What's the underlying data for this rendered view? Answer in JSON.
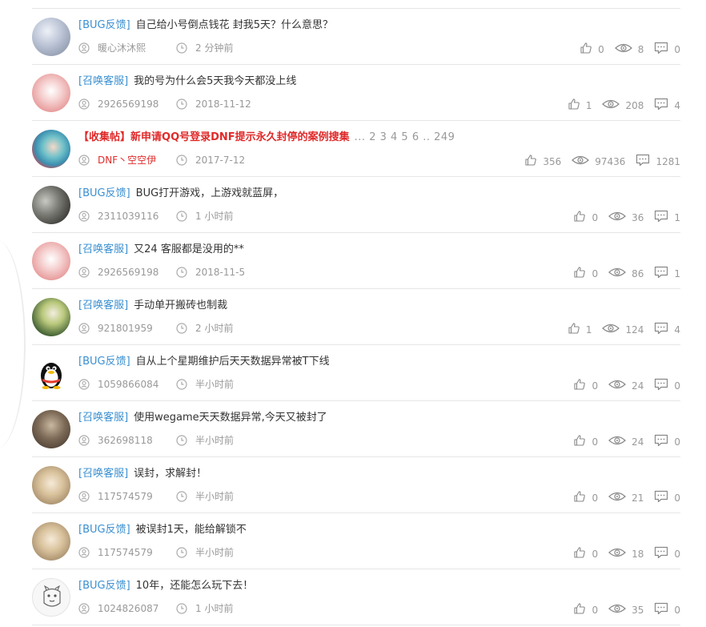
{
  "threads": [
    {
      "category": "[BUG反馈]",
      "title": "自己给小号倒点钱花 封我5天？什么意思？",
      "author": "暖心沐沐熙",
      "time": "2 分钟前",
      "likes": "0",
      "views": "8",
      "comments": "0",
      "avatar": "avatar-couple",
      "style": "normal"
    },
    {
      "category": "[召唤客服]",
      "title": "我的号为什么会5天我今天都没上线",
      "author": "2926569198",
      "time": "2018-11-12",
      "likes": "1",
      "views": "208",
      "comments": "4",
      "avatar": "avatar-pink",
      "style": "normal"
    },
    {
      "category": "【收集帖】",
      "title": "新申请QQ号登录DNF提示永久封停的案例搜集",
      "pages": "... 2  3  4  5  6 .. 249",
      "author": "DNF丶空空伊",
      "time": "2017-7-12",
      "likes": "356",
      "views": "97436",
      "comments": "1281",
      "avatar": "avatar-anime",
      "style": "sticky"
    },
    {
      "category": "[BUG反馈]",
      "title": "BUG打开游戏，上游戏就蓝屏，",
      "author": "2311039116",
      "time": "1 小时前",
      "likes": "0",
      "views": "36",
      "comments": "1",
      "avatar": "avatar-dark",
      "style": "normal"
    },
    {
      "category": "[召唤客服]",
      "title": "又24 客服都是没用的**",
      "author": "2926569198",
      "time": "2018-11-5",
      "likes": "0",
      "views": "86",
      "comments": "1",
      "avatar": "avatar-pink",
      "style": "normal"
    },
    {
      "category": "[召唤客服]",
      "title": "手动单开搬砖也制裁",
      "author": "921801959",
      "time": "2 小时前",
      "likes": "1",
      "views": "124",
      "comments": "4",
      "avatar": "avatar-green",
      "style": "normal"
    },
    {
      "category": "[BUG反馈]",
      "title": "自从上个星期维护后天天数据异常被T下线",
      "author": "1059866084",
      "time": "半小时前",
      "likes": "0",
      "views": "24",
      "comments": "0",
      "avatar": "avatar-penguin",
      "style": "normal"
    },
    {
      "category": "[召唤客服]",
      "title": "使用wegame天天数据异常,今天又被封了",
      "author": "362698118",
      "time": "半小时前",
      "likes": "0",
      "views": "24",
      "comments": "0",
      "avatar": "avatar-scene",
      "style": "normal"
    },
    {
      "category": "[召唤客服]",
      "title": "误封，求解封！",
      "author": "117574579",
      "time": "半小时前",
      "likes": "0",
      "views": "21",
      "comments": "0",
      "avatar": "avatar-blond",
      "style": "normal"
    },
    {
      "category": "[BUG反馈]",
      "title": "被误封1天，能给解锁不",
      "author": "117574579",
      "time": "半小时前",
      "likes": "0",
      "views": "18",
      "comments": "0",
      "avatar": "avatar-blond",
      "style": "normal"
    },
    {
      "category": "[BUG反馈]",
      "title": "10年，还能怎么玩下去！",
      "author": "1024826087",
      "time": "1 小时前",
      "likes": "0",
      "views": "35",
      "comments": "0",
      "avatar": "avatar-sketch",
      "style": "normal"
    }
  ],
  "colors": {
    "category": "#3a8fd0",
    "sticky": "#e02a2a",
    "meta": "#999999",
    "divider": "#e6e6e6"
  },
  "icons": {
    "author": "user-circle-icon",
    "time": "clock-icon",
    "likes": "thumbs-up-icon",
    "views": "eye-icon",
    "comments": "comment-icon"
  }
}
